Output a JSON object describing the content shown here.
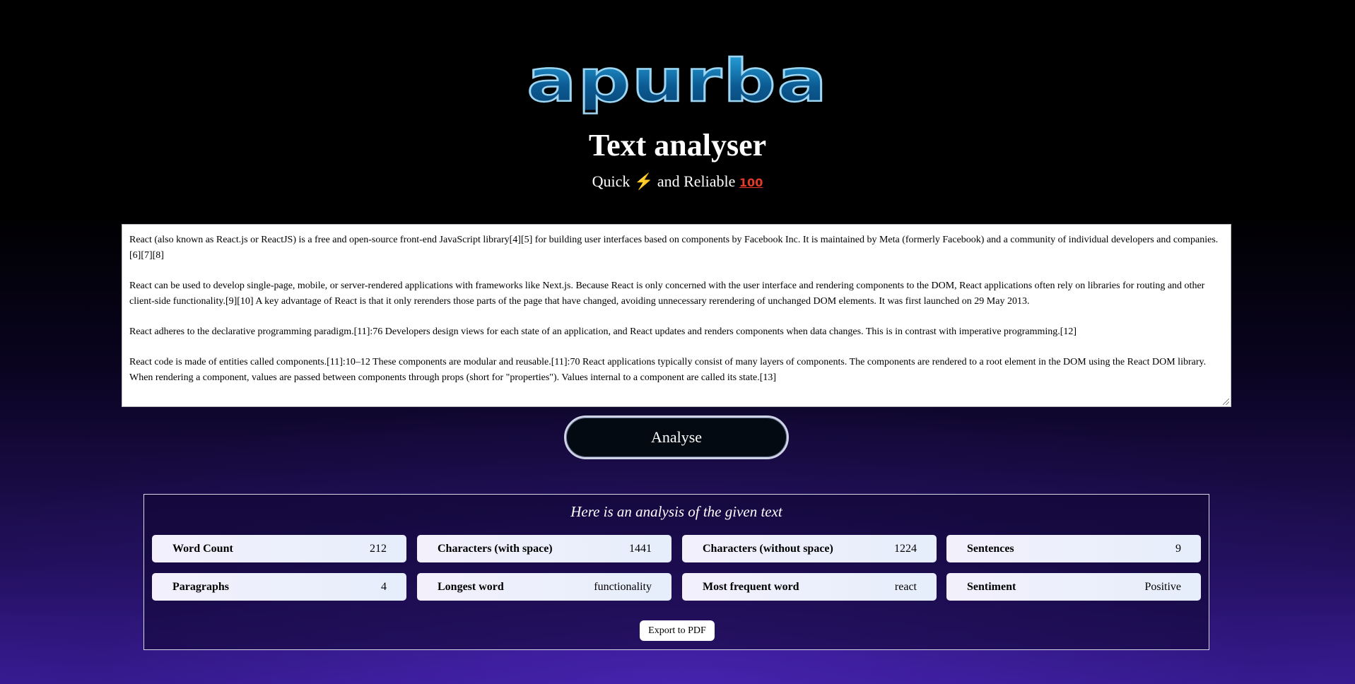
{
  "logo": {
    "text": "apurba"
  },
  "header": {
    "title": "Text analyser",
    "subtitle_pre": "Quick ",
    "subtitle_bolt": "⚡",
    "subtitle_mid": " and Reliable ",
    "subtitle_hundred": "100"
  },
  "input": {
    "paragraphs": [
      "React (also known as React.js or ReactJS) is a free and open-source front-end JavaScript library[4][5] for building user interfaces based on components by Facebook Inc. It is maintained by Meta (formerly Facebook) and a community of individual developers and companies.[6][7][8]",
      "React can be used to develop single-page, mobile, or server-rendered applications with frameworks like Next.js. Because React is only concerned with the user interface and rendering components to the DOM, React applications often rely on libraries for routing and other client-side functionality.[9][10] A key advantage of React is that it only rerenders those parts of the page that have changed, avoiding unnecessary rerendering of unchanged DOM elements. It was first launched on 29 May 2013.",
      "React adheres to the declarative programming paradigm.[11]:76 Developers design views for each state of an application, and React updates and renders components when data changes. This is in contrast with imperative programming.[12]",
      "React code is made of entities called components.[11]:10–12 These components are modular and reusable.[11]:70 React applications typically consist of many layers of components. The components are rendered to a root element in the DOM using the React DOM library. When rendering a component, values are passed between components through props (short for \"properties\"). Values internal to a component are called its state.[13]"
    ]
  },
  "actions": {
    "analyse_label": "Analyse",
    "export_label": "Export to PDF"
  },
  "results": {
    "heading": "Here is an analysis of the given text",
    "stats": [
      {
        "label": "Word Count",
        "value": "212"
      },
      {
        "label": "Characters (with space)",
        "value": "1441"
      },
      {
        "label": "Characters (without space)",
        "value": "1224"
      },
      {
        "label": "Sentences",
        "value": "9"
      },
      {
        "label": "Paragraphs",
        "value": "4"
      },
      {
        "label": "Longest word",
        "value": "functionality"
      },
      {
        "label": "Most frequent word",
        "value": "react"
      },
      {
        "label": "Sentiment",
        "value": "Positive"
      }
    ]
  }
}
